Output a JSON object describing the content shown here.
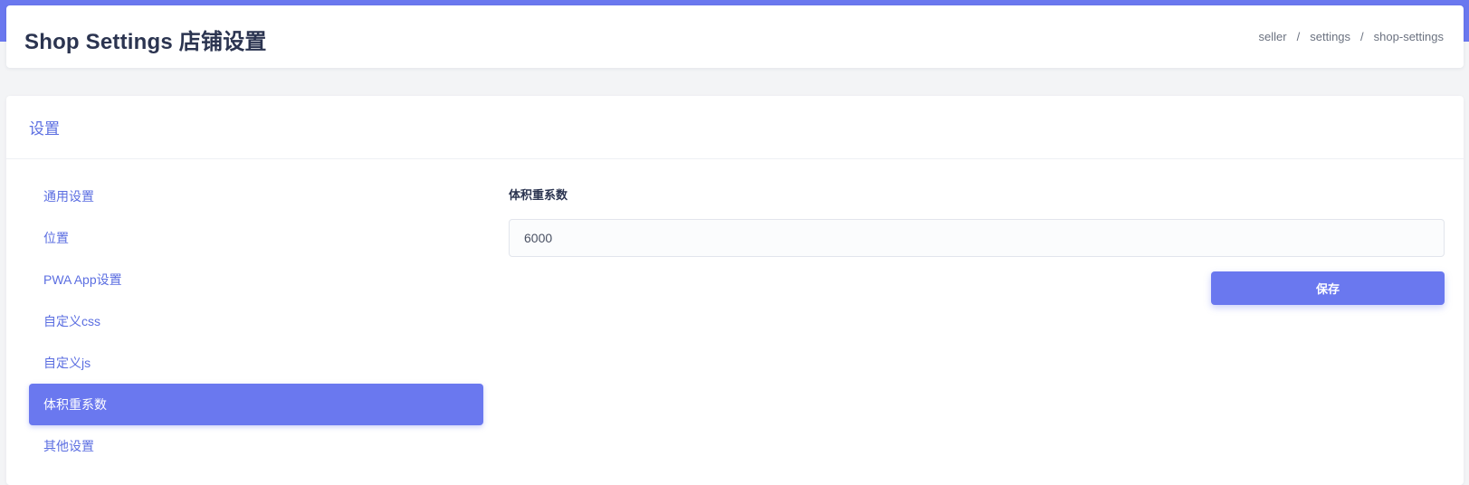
{
  "header": {
    "title": "Shop Settings 店铺设置",
    "breadcrumb": [
      "seller",
      "settings",
      "shop-settings"
    ],
    "breadcrumb_separator": "/"
  },
  "card": {
    "title": "设置"
  },
  "sidebar": {
    "items": [
      {
        "label": "通用设置",
        "active": false
      },
      {
        "label": "位置",
        "active": false
      },
      {
        "label": "PWA App设置",
        "active": false
      },
      {
        "label": "自定义css",
        "active": false
      },
      {
        "label": "自定义js",
        "active": false
      },
      {
        "label": "体积重系数",
        "active": true
      },
      {
        "label": "其他设置",
        "active": false
      }
    ]
  },
  "form": {
    "field_label": "体积重系数",
    "field_value": "6000",
    "save_label": "保存"
  },
  "colors": {
    "accent": "#6a78ef",
    "title_text": "#2b3450",
    "link_text": "#5b6ee1",
    "page_bg": "#f3f4f6"
  }
}
